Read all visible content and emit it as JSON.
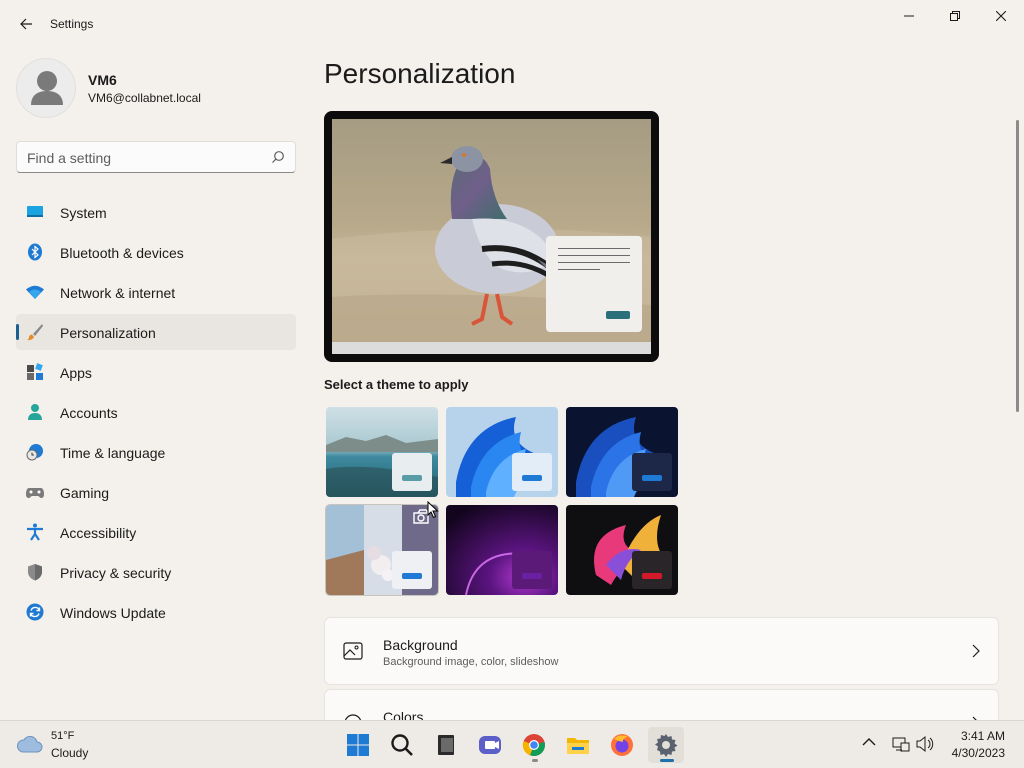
{
  "window": {
    "title": "Settings",
    "controls": {
      "minimize": "minimize",
      "maximize": "maximize",
      "close": "close"
    }
  },
  "profile": {
    "name": "VM6",
    "email": "VM6@collabnet.local"
  },
  "search": {
    "placeholder": "Find a setting",
    "value": ""
  },
  "sidebar": {
    "items": [
      {
        "label": "System",
        "icon": "monitor-icon",
        "active": false
      },
      {
        "label": "Bluetooth & devices",
        "icon": "bluetooth-icon",
        "active": false
      },
      {
        "label": "Network & internet",
        "icon": "wifi-icon",
        "active": false
      },
      {
        "label": "Personalization",
        "icon": "paintbrush-icon",
        "active": true
      },
      {
        "label": "Apps",
        "icon": "apps-icon",
        "active": false
      },
      {
        "label": "Accounts",
        "icon": "person-icon",
        "active": false
      },
      {
        "label": "Time & language",
        "icon": "globe-clock-icon",
        "active": false
      },
      {
        "label": "Gaming",
        "icon": "gamepad-icon",
        "active": false
      },
      {
        "label": "Accessibility",
        "icon": "accessibility-icon",
        "active": false
      },
      {
        "label": "Privacy & security",
        "icon": "shield-icon",
        "active": false
      },
      {
        "label": "Windows Update",
        "icon": "update-icon",
        "active": false
      }
    ]
  },
  "main": {
    "title": "Personalization",
    "themes_label": "Select a theme to apply",
    "themes": [
      {
        "name": "lake-theme",
        "accent": "#5a9ca6"
      },
      {
        "name": "windows-light-theme",
        "accent": "#1f7ad4"
      },
      {
        "name": "windows-dark-theme",
        "accent": "#1f7ad4"
      },
      {
        "name": "captured-motion-theme",
        "accent": "#1f7ad4",
        "selected": true
      },
      {
        "name": "glow-theme",
        "accent": "#6b1fa3"
      },
      {
        "name": "flow-theme",
        "accent": "#d21a2a"
      }
    ],
    "cards": [
      {
        "title": "Background",
        "subtitle": "Background image, color, slideshow",
        "icon": "image-icon"
      },
      {
        "title": "Colors",
        "subtitle": "",
        "icon": "palette-icon"
      }
    ]
  },
  "taskbar": {
    "weather": {
      "temp": "51°F",
      "condition": "Cloudy"
    },
    "apps": [
      "start-icon",
      "search-icon",
      "task-view-icon",
      "teams-chat-icon",
      "chrome-icon",
      "file-explorer-icon",
      "firefox-icon",
      "settings-icon"
    ],
    "clock": {
      "time": "3:41 AM",
      "date": "4/30/2023"
    }
  },
  "colors": {
    "accent": "#1f5f8f",
    "window_bg": "#f4f1ec",
    "taskbar_bg": "#eeebe6"
  }
}
